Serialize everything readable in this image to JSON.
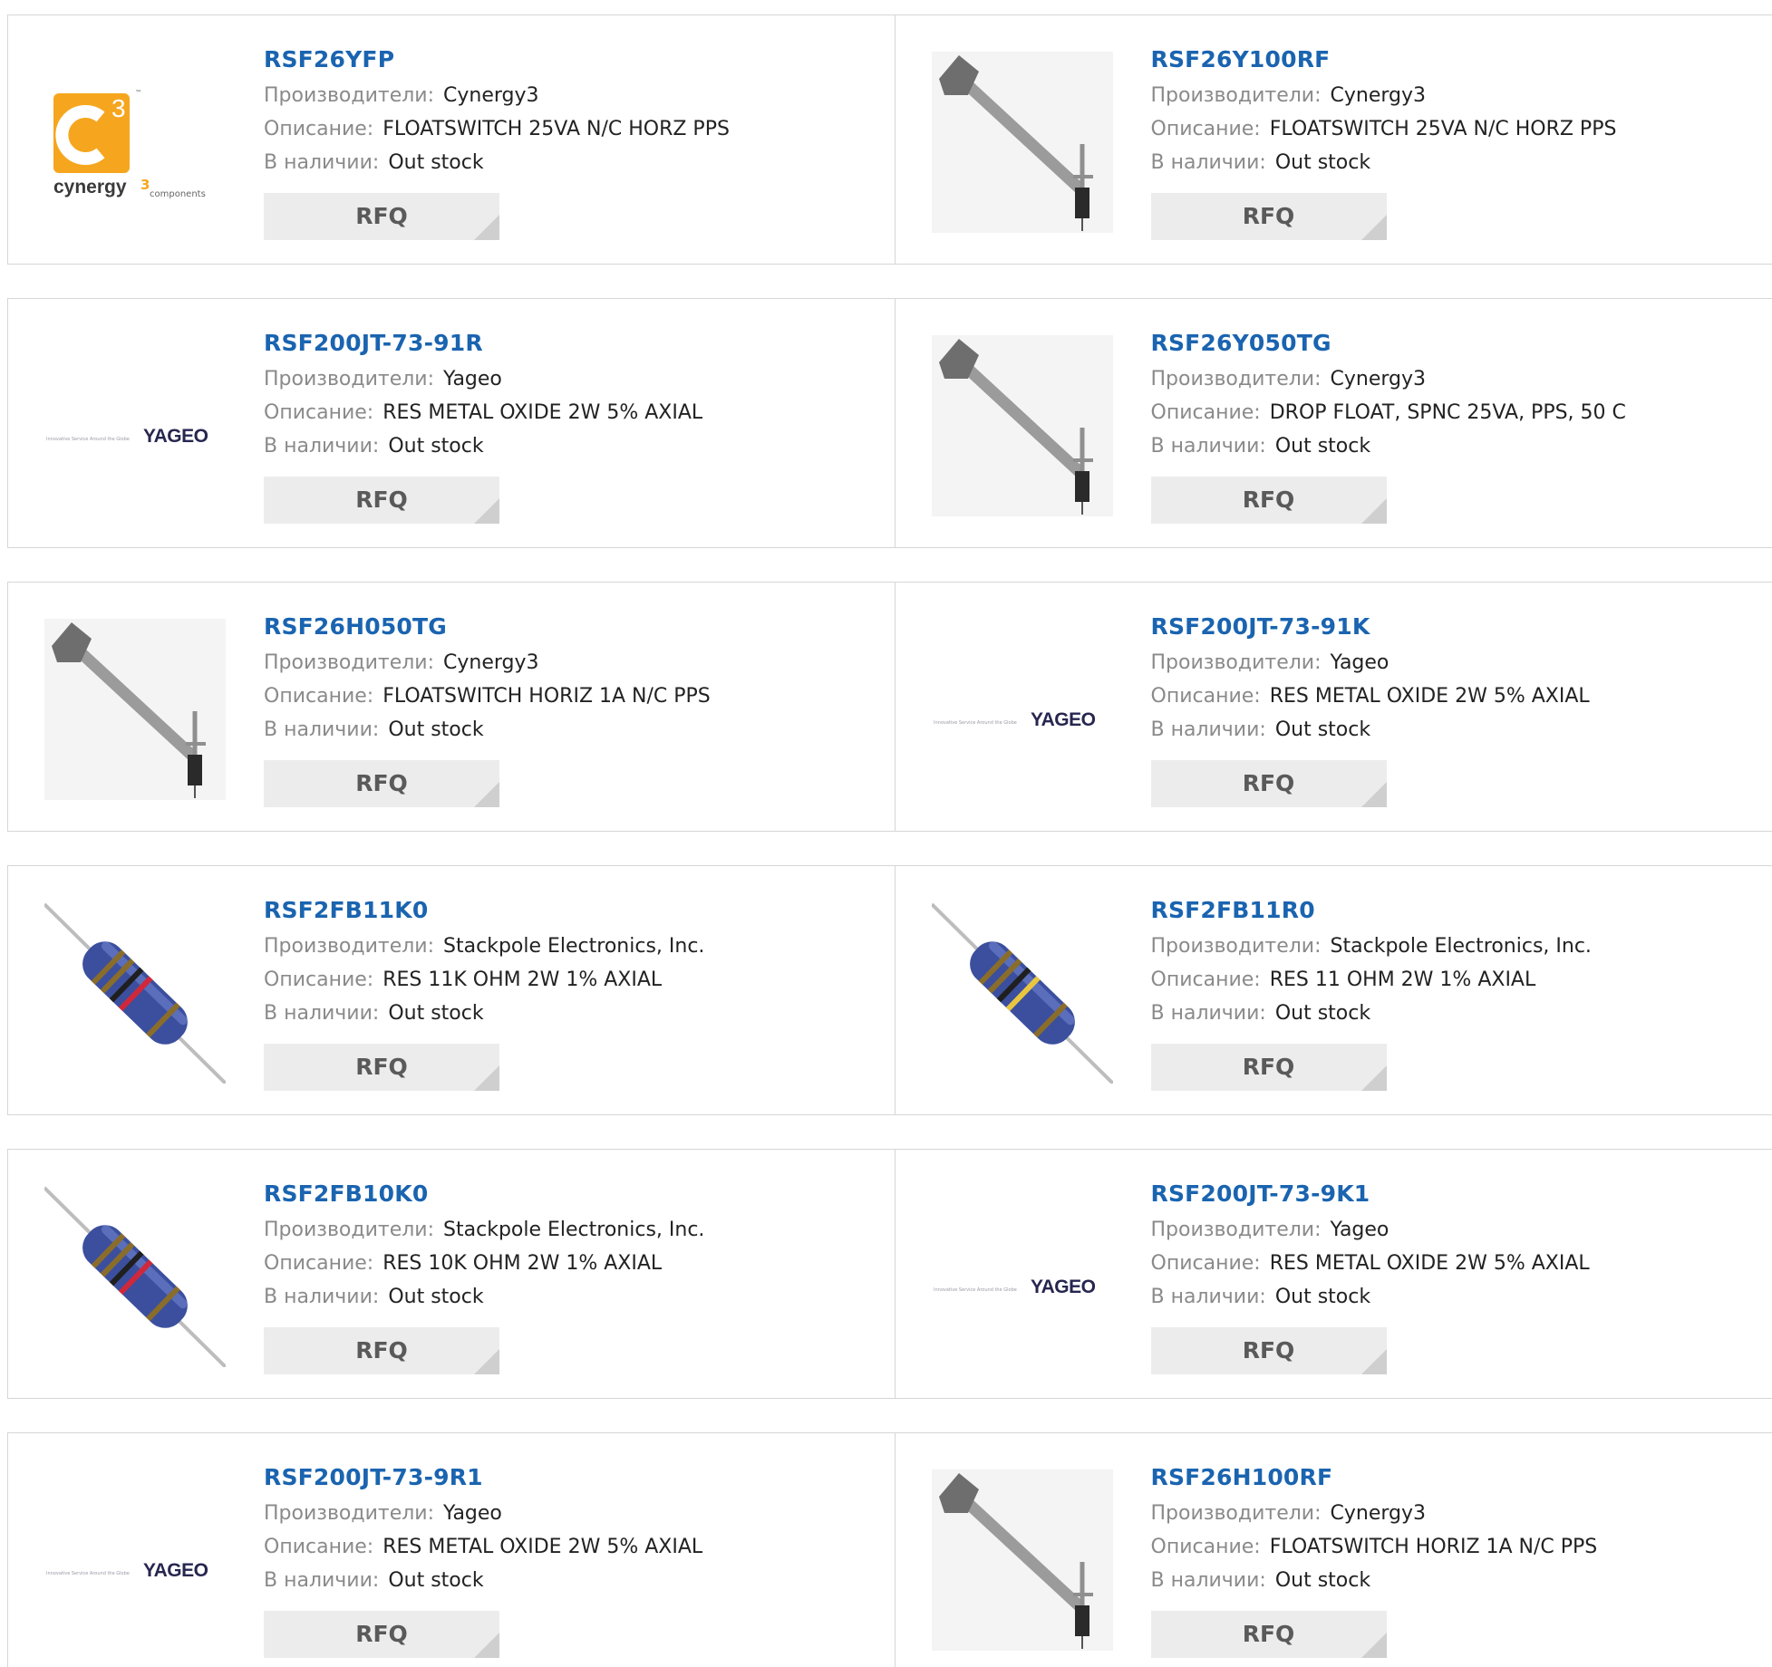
{
  "labels": {
    "manufacturer": "Производители:",
    "description": "Описание:",
    "stock": "В наличии:",
    "rfq": "RFQ"
  },
  "brands": {
    "cynergy3_word": "cynergy",
    "cynergy3_sup": "3",
    "cynergy3_sub": "components",
    "cynergy3_tm": "™",
    "yageo_word": "YAGEO",
    "yageo_tagline": "Innovative Service Around the Globe"
  },
  "colors": {
    "part_link": "#1a64b0",
    "label": "#8a8a8a",
    "rfq_bg": "#ececec",
    "cynergy_orange": "#f6a61e",
    "resistor_blue": "#3b4f9e"
  },
  "products": [
    {
      "part": "RSF26YFP",
      "manufacturer": "Cynergy3",
      "description": "FLOATSWITCH 25VA N/C HORZ PPS",
      "stock": "Out stock",
      "image": "cynergy3-logo"
    },
    {
      "part": "RSF26Y100RF",
      "manufacturer": "Cynergy3",
      "description": "FLOATSWITCH 25VA N/C HORZ PPS",
      "stock": "Out stock",
      "image": "float-switch"
    },
    {
      "part": "RSF200JT-73-91R",
      "manufacturer": "Yageo",
      "description": "RES METAL OXIDE 2W 5% AXIAL",
      "stock": "Out stock",
      "image": "yageo-logo"
    },
    {
      "part": "RSF26Y050TG",
      "manufacturer": "Cynergy3",
      "description": "DROP FLOAT, SPNC 25VA, PPS, 50 C",
      "stock": "Out stock",
      "image": "float-switch"
    },
    {
      "part": "RSF26H050TG",
      "manufacturer": "Cynergy3",
      "description": "FLOATSWITCH HORIZ 1A N/C PPS",
      "stock": "Out stock",
      "image": "float-switch"
    },
    {
      "part": "RSF200JT-73-91K",
      "manufacturer": "Yageo",
      "description": "RES METAL OXIDE 2W 5% AXIAL",
      "stock": "Out stock",
      "image": "yageo-logo"
    },
    {
      "part": "RSF2FB11K0",
      "manufacturer": "Stackpole Electronics, Inc.",
      "description": "RES 11K OHM 2W 1% AXIAL",
      "stock": "Out stock",
      "image": "resistor-red-band"
    },
    {
      "part": "RSF2FB11R0",
      "manufacturer": "Stackpole Electronics, Inc.",
      "description": "RES 11 OHM 2W 1% AXIAL",
      "stock": "Out stock",
      "image": "resistor-gold-band"
    },
    {
      "part": "RSF2FB10K0",
      "manufacturer": "Stackpole Electronics, Inc.",
      "description": "RES 10K OHM 2W 1% AXIAL",
      "stock": "Out stock",
      "image": "resistor-red-band"
    },
    {
      "part": "RSF200JT-73-9K1",
      "manufacturer": "Yageo",
      "description": "RES METAL OXIDE 2W 5% AXIAL",
      "stock": "Out stock",
      "image": "yageo-logo"
    },
    {
      "part": "RSF200JT-73-9R1",
      "manufacturer": "Yageo",
      "description": "RES METAL OXIDE 2W 5% AXIAL",
      "stock": "Out stock",
      "image": "yageo-logo"
    },
    {
      "part": "RSF26H100RF",
      "manufacturer": "Cynergy3",
      "description": "FLOATSWITCH HORIZ 1A N/C PPS",
      "stock": "Out stock",
      "image": "float-switch"
    }
  ]
}
